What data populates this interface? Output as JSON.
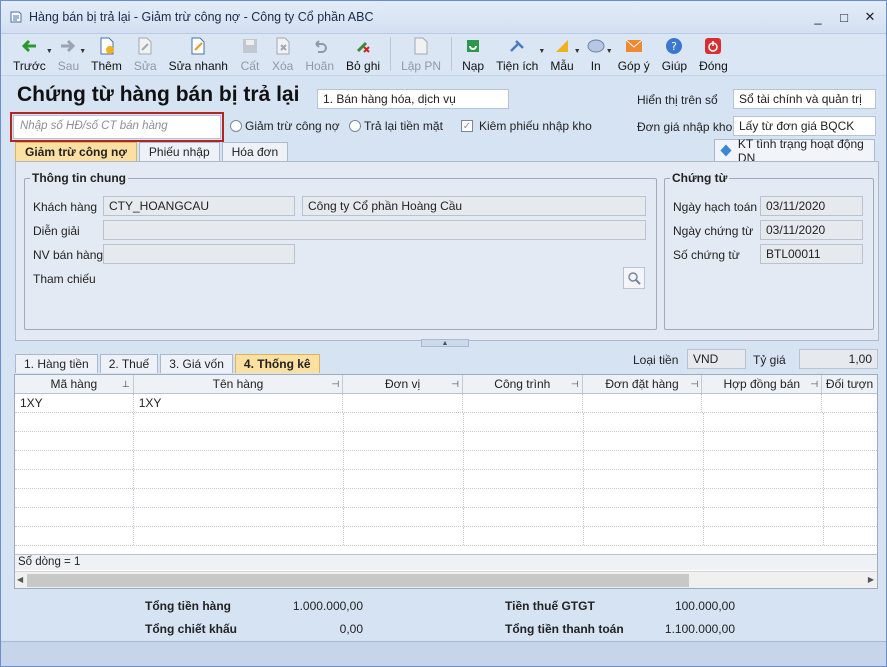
{
  "window": {
    "title": "Hàng bán bị trả lại - Giảm trừ công nợ - Công ty Cổ phần ABC",
    "minimize": "_",
    "maximize": "□",
    "close": "✕"
  },
  "toolbar": {
    "prev": "Trước",
    "next": "Sau",
    "add": "Thêm",
    "edit": "Sửa",
    "quick_edit": "Sửa nhanh",
    "save": "Cất",
    "delete": "Xóa",
    "undo": "Hoãn",
    "unpost": "Bỏ ghi",
    "create_pn": "Lập PN",
    "reload": "Nạp",
    "utilities": "Tiện ích",
    "template": "Mẫu",
    "print": "In",
    "feedback": "Góp ý",
    "help": "Giúp",
    "close": "Đóng"
  },
  "form": {
    "heading": "Chứng từ hàng bán bị trả lại",
    "type_value": "1. Bán hàng hóa, dịch vụ",
    "search_placeholder": "Nhập số HĐ/số CT bán hàng",
    "radio_reduce": "Giảm trừ công nợ",
    "radio_refund": "Trả lại tiền mặt",
    "check_receipt": "Kiêm phiếu nhập kho",
    "display_on_label": "Hiển thị trên sổ",
    "display_on_value": "Sổ tài chính và quản trị",
    "unit_price_label": "Đơn giá nhập kho",
    "unit_price_value": "Lấy từ đơn giá BQCK"
  },
  "top_tabs": [
    "Giảm trừ công nợ",
    "Phiếu nhập",
    "Hóa đơn"
  ],
  "kt_button": "KT tình trạng hoạt động DN",
  "general": {
    "title": "Thông tin chung",
    "customer_label": "Khách hàng",
    "customer_code": "CTY_HOANGCAU",
    "customer_name": "Công ty Cổ phần Hoàng Cầu",
    "description_label": "Diễn giải",
    "description_value": "",
    "sales_staff_label": "NV bán hàng",
    "sales_staff_value": "",
    "reference_label": "Tham chiếu"
  },
  "voucher": {
    "title": "Chứng từ",
    "posting_date_label": "Ngày hạch toán",
    "posting_date": "03/11/2020",
    "voucher_date_label": "Ngày chứng từ",
    "voucher_date": "03/11/2020",
    "voucher_no_label": "Số chứng từ",
    "voucher_no": "BTL00011"
  },
  "bottom_tabs": [
    "1. Hàng tiền",
    "2. Thuế",
    "3. Giá vốn",
    "4. Thống kê"
  ],
  "currency": {
    "label": "Loại tiền",
    "value": "VND",
    "rate_label": "Tỷ giá",
    "rate_value": "1,00"
  },
  "grid": {
    "columns": [
      "Mã hàng",
      "Tên hàng",
      "Đơn vị",
      "Công trình",
      "Đơn đặt hàng",
      "Hợp đồng bán",
      "Đối tượn"
    ],
    "rows": [
      [
        "1XY",
        "1XY",
        "",
        "",
        "",
        "",
        ""
      ]
    ],
    "row_count": "Số dòng = 1"
  },
  "totals": {
    "goods_label": "Tổng tiền hàng",
    "goods_value": "1.000.000,00",
    "discount_label": "Tổng chiết khấu",
    "discount_value": "0,00",
    "vat_label": "Tiền thuế GTGT",
    "vat_value": "100.000,00",
    "payment_label": "Tổng tiền thanh toán",
    "payment_value": "1.100.000,00"
  }
}
